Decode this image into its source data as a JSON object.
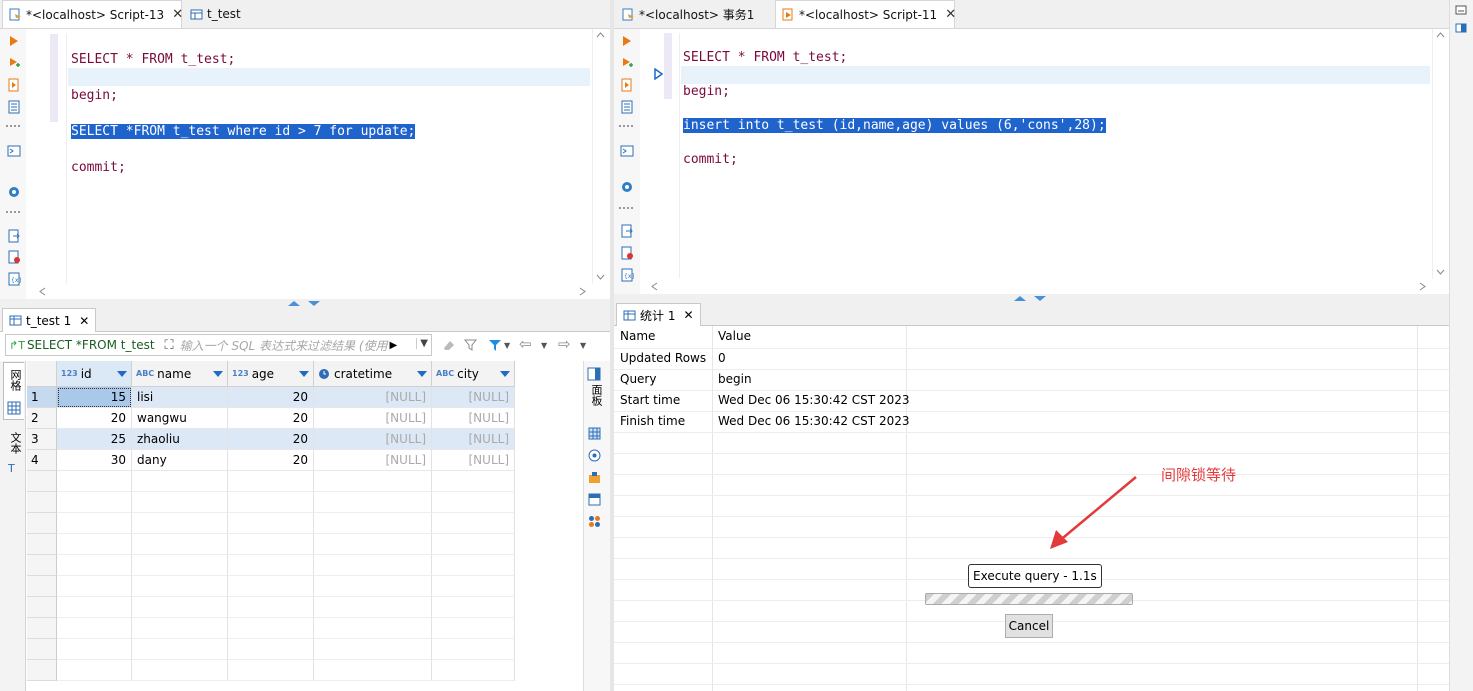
{
  "left_editor": {
    "tabs": [
      {
        "label": "*<localhost> Script-13",
        "close": "✕"
      },
      {
        "label": "t_test"
      }
    ],
    "lines": [
      {
        "text": "SELECT * FROM t_test;"
      },
      {
        "text": "begin;"
      },
      {
        "text": "SELECT *FROM t_test where id > 7 for update;"
      },
      {
        "text": "commit;"
      }
    ]
  },
  "right_editor": {
    "tabs": [
      {
        "label": "*<localhost> 事务1"
      },
      {
        "label": "*<localhost> Script-11",
        "close": "✕"
      }
    ],
    "lines": [
      {
        "text": "SELECT * FROM t_test;"
      },
      {
        "text": "begin;"
      },
      {
        "text": "insert into t_test (id,name,age) values (6,'cons',28);"
      },
      {
        "text": "commit;"
      }
    ]
  },
  "results": {
    "tab_label": "t_test 1",
    "tab_close": "✕",
    "query_label": "SELECT *FROM t_test",
    "filter_placeholder": "输入一个 SQL 表达式来过滤结果 (使用",
    "side_tabs": {
      "grid": "网格",
      "text": "文本"
    },
    "right_side_label": "面板",
    "columns": [
      {
        "name": "id",
        "type": "123"
      },
      {
        "name": "name",
        "type": "ABC"
      },
      {
        "name": "age",
        "type": "123"
      },
      {
        "name": "cratetime",
        "type": "clock"
      },
      {
        "name": "city",
        "type": "ABC"
      }
    ],
    "rows": [
      {
        "num": "1",
        "id": "15",
        "name": "lisi",
        "age": "20",
        "cratetime": "[NULL]",
        "city": "[NULL]"
      },
      {
        "num": "2",
        "id": "20",
        "name": "wangwu",
        "age": "20",
        "cratetime": "[NULL]",
        "city": "[NULL]"
      },
      {
        "num": "3",
        "id": "25",
        "name": "zhaoliu",
        "age": "20",
        "cratetime": "[NULL]",
        "city": "[NULL]"
      },
      {
        "num": "4",
        "id": "30",
        "name": "dany",
        "age": "20",
        "cratetime": "[NULL]",
        "city": "[NULL]"
      }
    ]
  },
  "stats": {
    "tab_label": "统计 1",
    "tab_close": "✕",
    "header": {
      "name": "Name",
      "value": "Value"
    },
    "rows": [
      {
        "name": "Updated Rows",
        "value": "0"
      },
      {
        "name": "Query",
        "value": "begin"
      },
      {
        "name": "Start time",
        "value": "Wed Dec 06 15:30:42 CST 2023"
      },
      {
        "name": "Finish time",
        "value": "Wed Dec 06 15:30:42 CST 2023"
      }
    ],
    "annotation": "间隙锁等待",
    "progress_label": "Execute query - 1.1s",
    "cancel_label": "Cancel"
  },
  "colors": {
    "selection": "#1f63cc",
    "keyword": "#7a0a3c",
    "annotation": "#e23b3b",
    "accent": "#1d6cc2"
  }
}
